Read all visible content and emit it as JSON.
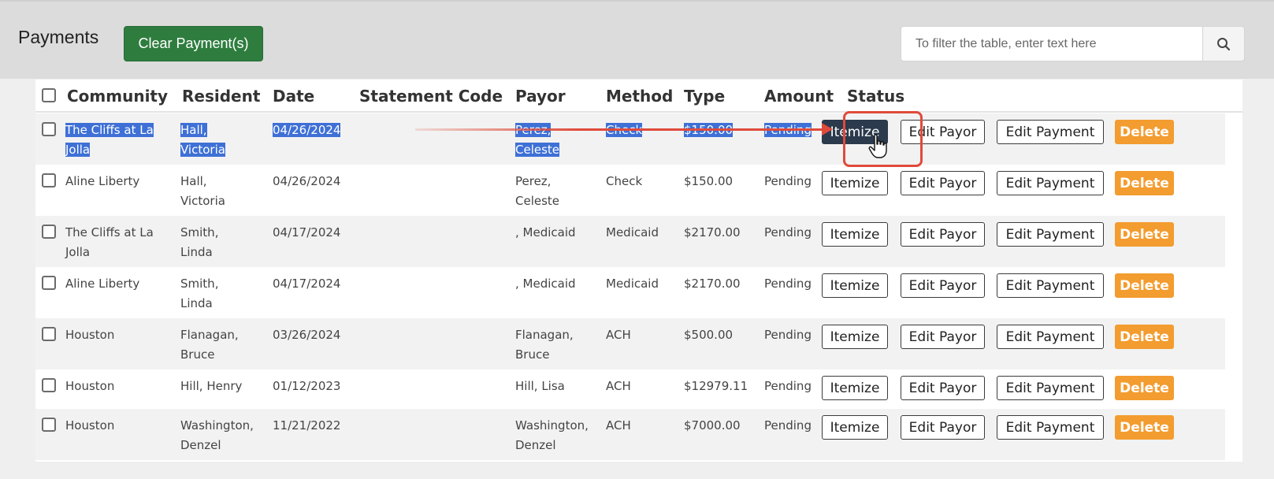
{
  "header": {
    "title": "Payments",
    "clear_button": "Clear Payment(s)",
    "search_placeholder": "To filter the table, enter text here"
  },
  "table": {
    "columns": [
      "Community",
      "Resident",
      "Date",
      "Statement Code",
      "Payor",
      "Method",
      "Type",
      "Amount",
      "Status"
    ],
    "rows": [
      {
        "community": [
          "The Cliffs at La",
          "Jolla"
        ],
        "resident": [
          "Hall,",
          "Victoria"
        ],
        "date": "04/26/2024",
        "payor": [
          "Perez,",
          "Celeste"
        ],
        "method": "Check",
        "amount": "$150.00",
        "status": "Pending",
        "selected": true
      },
      {
        "community": [
          "Aline Liberty"
        ],
        "resident": [
          "Hall,",
          "Victoria"
        ],
        "date": "04/26/2024",
        "payor": [
          "Perez,",
          "Celeste"
        ],
        "method": "Check",
        "amount": "$150.00",
        "status": "Pending"
      },
      {
        "community": [
          "The Cliffs at La",
          "Jolla"
        ],
        "resident": [
          "Smith,",
          "Linda"
        ],
        "date": "04/17/2024",
        "payor": [
          ", Medicaid"
        ],
        "method": "Medicaid",
        "amount": "$2170.00",
        "status": "Pending"
      },
      {
        "community": [
          "Aline Liberty"
        ],
        "resident": [
          "Smith,",
          "Linda"
        ],
        "date": "04/17/2024",
        "payor": [
          ", Medicaid"
        ],
        "method": "Medicaid",
        "amount": "$2170.00",
        "status": "Pending"
      },
      {
        "community": [
          "Houston"
        ],
        "resident": [
          "Flanagan,",
          "Bruce"
        ],
        "date": "03/26/2024",
        "payor": [
          "Flanagan,",
          "Bruce"
        ],
        "method": "ACH",
        "amount": "$500.00",
        "status": "Pending"
      },
      {
        "community": [
          "Houston"
        ],
        "resident": [
          "Hill, Henry"
        ],
        "date": "01/12/2023",
        "payor": [
          "Hill, Lisa"
        ],
        "method": "ACH",
        "amount": "$12979.11",
        "status": "Pending"
      },
      {
        "community": [
          "Houston"
        ],
        "resident": [
          "Washington,",
          "Denzel"
        ],
        "date": "11/21/2022",
        "payor": [
          "Washington,",
          "Denzel"
        ],
        "method": "ACH",
        "amount": "$7000.00",
        "status": "Pending"
      }
    ],
    "actions": {
      "itemize": "Itemize",
      "edit_payor": "Edit Payor",
      "edit_payment": "Edit Payment",
      "delete": "Delete"
    }
  },
  "colors": {
    "clear_button": "#2e7d3f",
    "delete_button": "#f39c2f",
    "selection": "#3e70d6",
    "highlight": "#e04a3a"
  }
}
